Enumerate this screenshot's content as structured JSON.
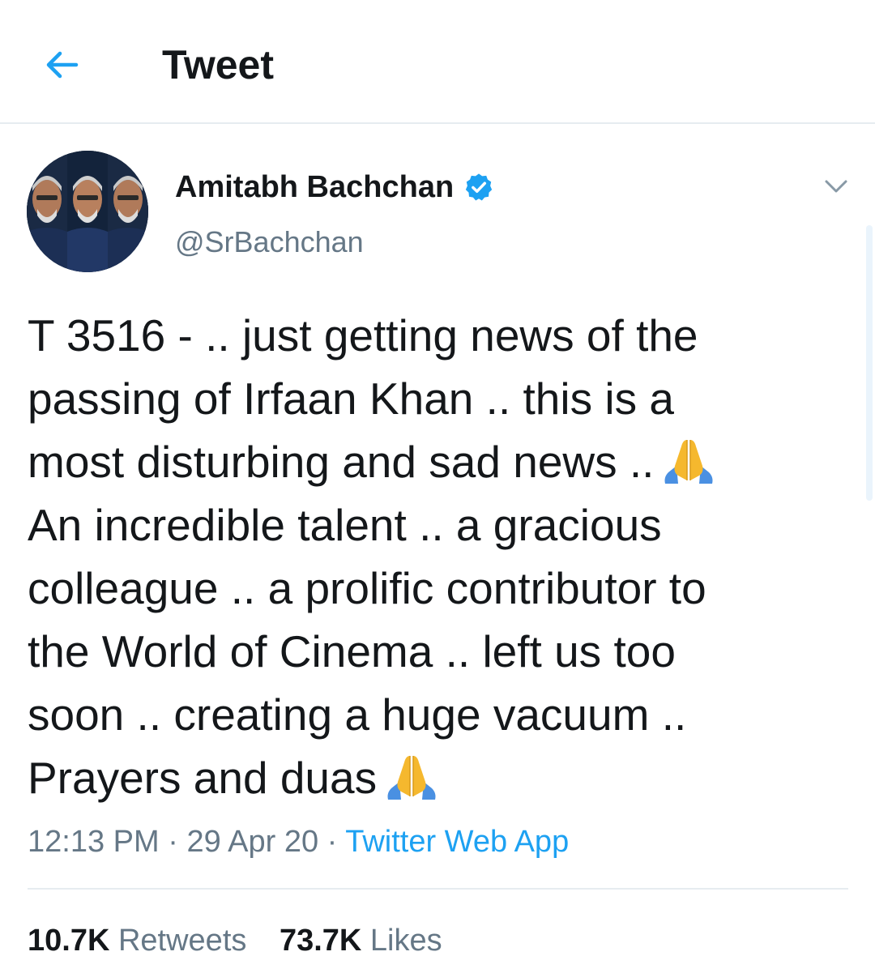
{
  "header": {
    "title": "Tweet",
    "back_icon": "arrow-left-icon"
  },
  "colors": {
    "accent": "#1da1f2",
    "text": "#14171a",
    "secondary": "#657786",
    "divider": "#e6ecf0"
  },
  "author": {
    "display_name": "Amitabh Bachchan",
    "handle": "@SrBachchan",
    "verified_icon": "verified-badge-icon",
    "menu_icon": "chevron-down-icon"
  },
  "tweet": {
    "lines": [
      "T 3516 - .. just getting news of the",
      "passing of Irfaan Khan .. this is a",
      "most disturbing and sad news ..",
      "An incredible talent .. a gracious",
      "colleague .. a prolific contributor to",
      "the World of Cinema .. left us too",
      "soon .. creating a huge vacuum ..",
      "Prayers and duas"
    ],
    "emoji_icon": "folded-hands-emoji-icon"
  },
  "meta": {
    "time": "12:13 PM",
    "separator": " · ",
    "date": "29 Apr 20",
    "source": "Twitter Web App"
  },
  "stats": {
    "retweets_count": "10.7K",
    "retweets_label": "Retweets",
    "likes_count": "73.7K",
    "likes_label": "Likes"
  }
}
